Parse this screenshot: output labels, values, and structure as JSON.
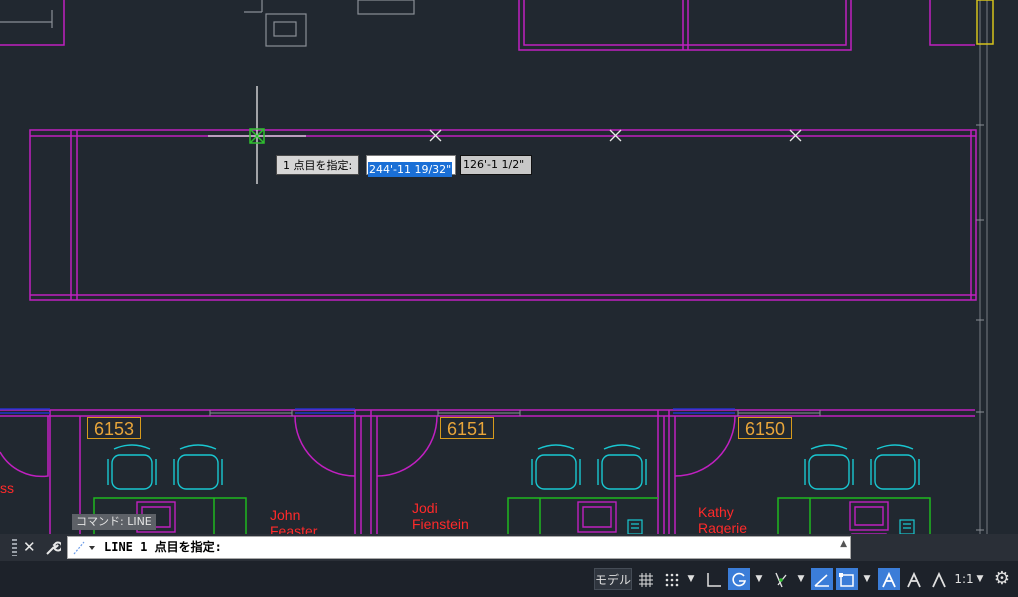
{
  "dynamic_input": {
    "prompt": "1 点目を指定:",
    "x_value": "244'-11 19/32\"",
    "y_value": "126'-1 1/2\""
  },
  "rooms": [
    {
      "number": "6153",
      "occupant": "John\nFeaster"
    },
    {
      "number": "6151",
      "occupant": "Jodi\nFienstein"
    },
    {
      "number": "6150",
      "occupant": "Kathy\nRagerie"
    }
  ],
  "partial_label": "ss",
  "command_history": "コマンド: LINE",
  "command_line": {
    "text": "LINE 1 点目を指定:",
    "close_icon": "close-icon",
    "customize_icon": "wrench-icon",
    "recent_icon": "recent-commands-icon"
  },
  "status_bar": {
    "model_label": "モデル",
    "scale_label": "1:1",
    "items": [
      "grid-icon",
      "snap-icon",
      "ortho-icon",
      "polar-icon",
      "isodraft-icon",
      "osnap-track-icon",
      "osnap-icon",
      "annotation-visibility-icon",
      "autoscale-icon",
      "annotation-scale-icon",
      "gear-icon"
    ]
  },
  "colors": {
    "background": "#212830",
    "walls": "#c020c0",
    "furniture": "#19c7d1",
    "desks": "#1fb81f",
    "labels": "#e8a53a",
    "names": "#ff2a2a",
    "cursor_marker": "#2fc02f"
  }
}
